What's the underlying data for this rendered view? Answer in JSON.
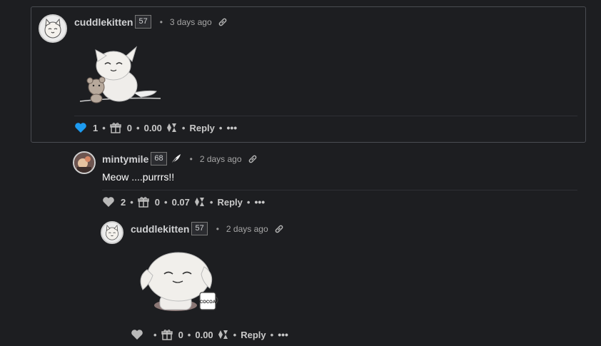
{
  "comments": [
    {
      "author": "cuddlekitten",
      "reputation": "57",
      "time": "3 days ago",
      "upvotes": "1",
      "gifts": "0",
      "payout": "0.00",
      "reply_label": "Reply",
      "more_label": "•••",
      "heart_color": "#1d9bf0"
    },
    {
      "author": "mintymile",
      "reputation": "68",
      "time": "2 days ago",
      "text": "Meow ....purrrs!!",
      "upvotes": "2",
      "gifts": "0",
      "payout": "0.07",
      "reply_label": "Reply",
      "more_label": "•••",
      "heart_color": "#b9b9b9"
    },
    {
      "author": "cuddlekitten",
      "reputation": "57",
      "time": "2 days ago",
      "upvotes": "",
      "gifts": "0",
      "payout": "0.00",
      "reply_label": "Reply",
      "more_label": "•••",
      "heart_color": "#b9b9b9",
      "mug_text": "COCOA"
    }
  ],
  "separator": "•"
}
